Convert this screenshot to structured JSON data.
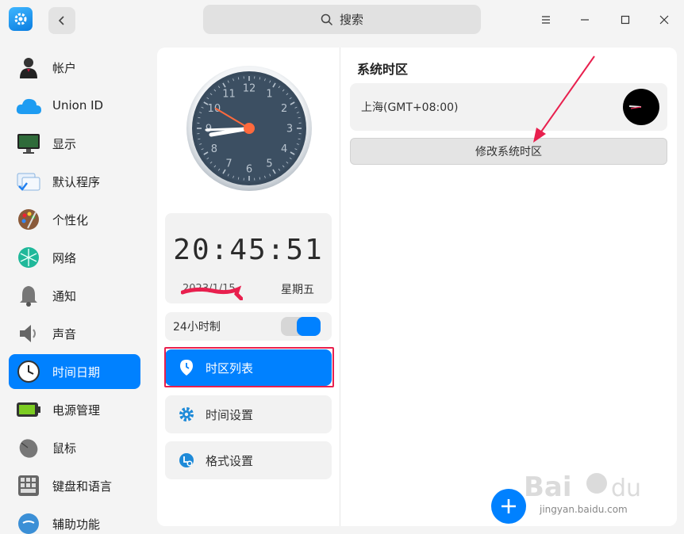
{
  "window": {
    "search_placeholder": "搜索"
  },
  "sidebar": {
    "items": [
      {
        "label": "帐户",
        "icon": "account-icon"
      },
      {
        "label": "Union ID",
        "icon": "cloud-icon"
      },
      {
        "label": "显示",
        "icon": "monitor-icon"
      },
      {
        "label": "默认程序",
        "icon": "default-apps-icon"
      },
      {
        "label": "个性化",
        "icon": "palette-icon"
      },
      {
        "label": "网络",
        "icon": "network-icon"
      },
      {
        "label": "通知",
        "icon": "bell-icon"
      },
      {
        "label": "声音",
        "icon": "speaker-icon"
      },
      {
        "label": "时间日期",
        "icon": "clock-icon",
        "active": true
      },
      {
        "label": "电源管理",
        "icon": "battery-icon"
      },
      {
        "label": "鼠标",
        "icon": "mouse-icon"
      },
      {
        "label": "键盘和语言",
        "icon": "keyboard-icon"
      },
      {
        "label": "辅助功能",
        "icon": "accessibility-icon"
      }
    ]
  },
  "clock": {
    "digital_time": "20:45:51",
    "date": "2023/1/15",
    "weekday": "星期五",
    "analog_numbers": [
      "12",
      "1",
      "2",
      "3",
      "4",
      "5",
      "6",
      "7",
      "8",
      "9",
      "10",
      "11"
    ]
  },
  "settings": {
    "hour24_label": "24小时制",
    "hour24_enabled": true,
    "menu": [
      {
        "label": "时区列表",
        "icon": "location-pin-icon",
        "active": true
      },
      {
        "label": "时间设置",
        "icon": "gear-icon"
      },
      {
        "label": "格式设置",
        "icon": "format-icon"
      }
    ]
  },
  "timezone": {
    "section_title": "系统时区",
    "current": "上海(GMT+08:00)",
    "change_button": "修改系统时区"
  },
  "watermark": {
    "text": "jingyan.baidu.com"
  },
  "colors": {
    "accent": "#0081ff",
    "annotation": "#e8204e"
  }
}
